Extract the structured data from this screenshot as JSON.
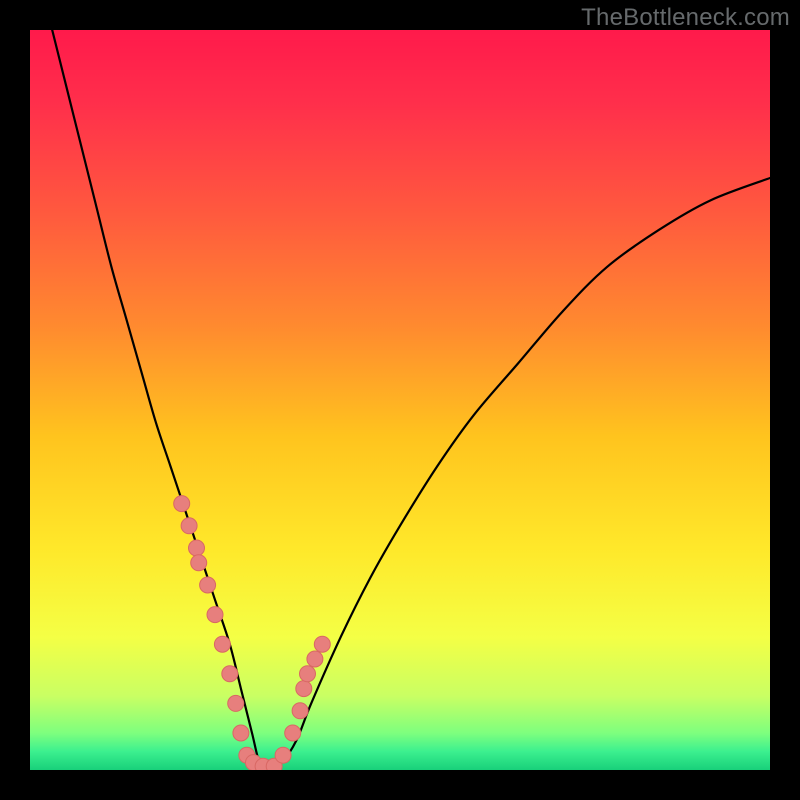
{
  "watermark": "TheBottleneck.com",
  "colors": {
    "frame": "#000000",
    "gradient_stops": [
      {
        "offset": 0.0,
        "color": "#ff1a4b"
      },
      {
        "offset": 0.1,
        "color": "#ff2f4b"
      },
      {
        "offset": 0.25,
        "color": "#ff5a3e"
      },
      {
        "offset": 0.4,
        "color": "#ff8a2f"
      },
      {
        "offset": 0.55,
        "color": "#ffc41e"
      },
      {
        "offset": 0.7,
        "color": "#ffe82a"
      },
      {
        "offset": 0.82,
        "color": "#f4ff45"
      },
      {
        "offset": 0.9,
        "color": "#c9ff63"
      },
      {
        "offset": 0.95,
        "color": "#7eff7e"
      },
      {
        "offset": 0.975,
        "color": "#3cf08f"
      },
      {
        "offset": 1.0,
        "color": "#18d07a"
      }
    ],
    "curve_stroke": "#000000",
    "marker_fill": "#e77f7d",
    "marker_stroke": "#d96864"
  },
  "chart_data": {
    "type": "line",
    "title": "",
    "xlabel": "",
    "ylabel": "",
    "xlim": [
      0,
      100
    ],
    "ylim": [
      0,
      100
    ],
    "grid": false,
    "series": [
      {
        "name": "bottleneck-curve",
        "x": [
          3,
          5,
          7,
          9,
          11,
          13,
          15,
          17,
          19,
          21,
          23,
          25,
          27,
          28.5,
          30,
          31,
          32,
          34,
          36,
          38,
          42,
          46,
          50,
          55,
          60,
          66,
          72,
          78,
          85,
          92,
          100
        ],
        "y": [
          100,
          92,
          84,
          76,
          68,
          61,
          54,
          47,
          41,
          35,
          29,
          23,
          17,
          11,
          5,
          1,
          0,
          1,
          4,
          9,
          18,
          26,
          33,
          41,
          48,
          55,
          62,
          68,
          73,
          77,
          80
        ]
      }
    ],
    "markers": {
      "name": "highlight-points",
      "x": [
        20.5,
        21.5,
        22.5,
        22.8,
        24.0,
        25.0,
        26.0,
        27.0,
        27.8,
        28.5,
        29.3,
        30.2,
        31.5,
        33.0,
        34.2,
        35.5,
        36.5,
        37.0,
        37.5,
        38.5,
        39.5
      ],
      "y": [
        36,
        33,
        30,
        28,
        25,
        21,
        17,
        13,
        9,
        5,
        2,
        1,
        0.5,
        0.5,
        2,
        5,
        8,
        11,
        13,
        15,
        17
      ]
    }
  }
}
